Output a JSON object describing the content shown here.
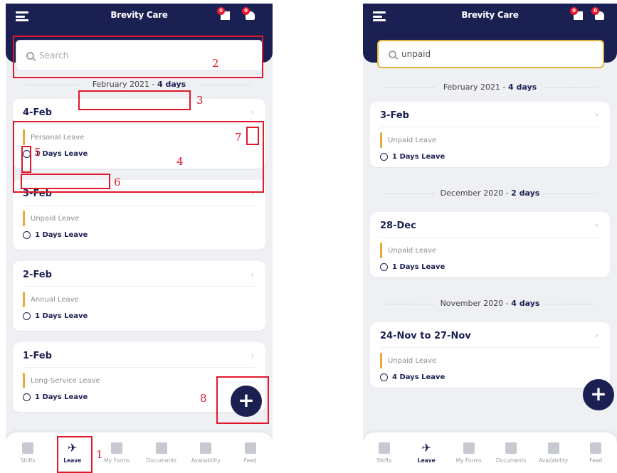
{
  "left": {
    "app_title": "Brevity Care",
    "header_badges": {
      "calendar": "0",
      "bell": "0"
    },
    "search": {
      "placeholder": "Search",
      "value": ""
    },
    "section": {
      "month": "February 2021",
      "sep": " - ",
      "days": "4 days"
    },
    "cards": [
      {
        "date": "4-Feb",
        "type": "Personal Leave",
        "duration": "1 Days Leave"
      },
      {
        "date": "3-Feb",
        "type": "Unpaid Leave",
        "duration": "1 Days Leave"
      },
      {
        "date": "2-Feb",
        "type": "Annual Leave",
        "duration": "1 Days Leave"
      },
      {
        "date": "1-Feb",
        "type": "Long-Service Leave",
        "duration": "1 Days Leave"
      }
    ],
    "fab": "+",
    "annotations": [
      "1",
      "2",
      "3",
      "4",
      "5",
      "6",
      "7",
      "8"
    ]
  },
  "right": {
    "app_title": "Brevity Care",
    "header_badges": {
      "calendar": "0",
      "bell": "0"
    },
    "search": {
      "value": "unpaid"
    },
    "sections": [
      {
        "month": "February 2021",
        "sep": " - ",
        "days": "4 days"
      },
      {
        "month": "December 2020",
        "sep": " - ",
        "days": "2 days"
      },
      {
        "month": "November 2020",
        "sep": " - ",
        "days": "4 days"
      }
    ],
    "cards": [
      {
        "date": "3-Feb",
        "type": "Unpaid Leave",
        "duration": "1 Days Leave"
      },
      {
        "date": "28-Dec",
        "type": "Unpaid Leave",
        "duration": "1 Days Leave"
      },
      {
        "date": "24-Nov to 27-Nov",
        "type": "Unpaid Leave",
        "duration": "4 Days Leave"
      }
    ],
    "fab": "+"
  },
  "nav": [
    {
      "label": "Shifts",
      "icon": "calendar-grid-icon"
    },
    {
      "label": "Leave",
      "icon": "airplane-icon"
    },
    {
      "label": "My Forms",
      "icon": "document-icon"
    },
    {
      "label": "Documents",
      "icon": "folder-icon"
    },
    {
      "label": "Availability",
      "icon": "calendar-x-icon"
    },
    {
      "label": "Feed",
      "icon": "chat-bubbles-icon"
    }
  ],
  "colors": {
    "navy": "#1b2053",
    "accent": "#e8a93a",
    "annotation": "#e0182c",
    "badge": "#e8192c"
  }
}
